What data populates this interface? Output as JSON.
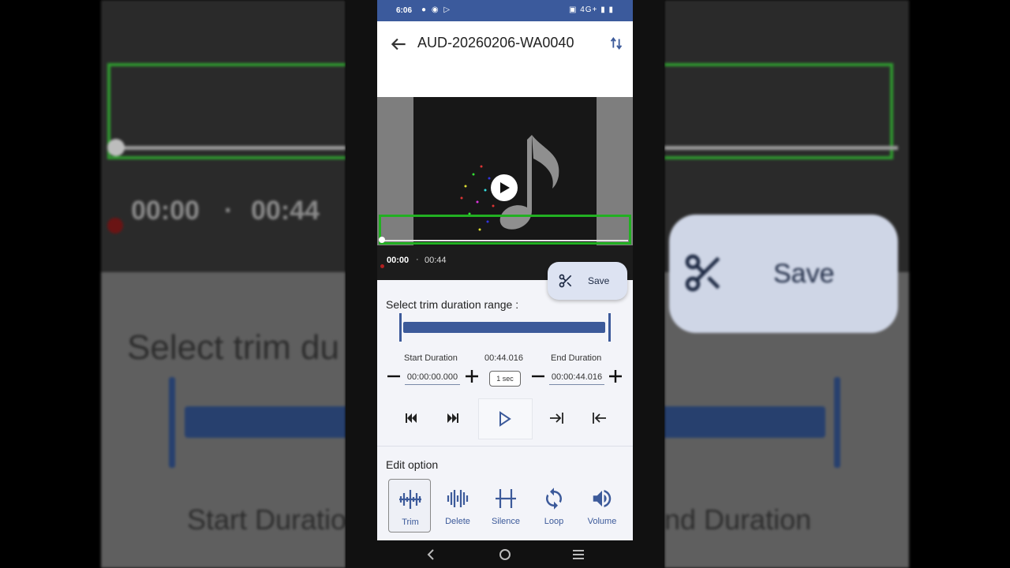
{
  "status_bar": {
    "time": "6:06",
    "network": "4G+"
  },
  "header": {
    "title": "AUD-20260206-WA0040"
  },
  "player": {
    "current_time": "00:00",
    "separator": "·",
    "total_time": "00:44"
  },
  "save_button": {
    "label": "Save"
  },
  "trim": {
    "section_label": "Select trim duration range :",
    "start_label": "Start Duration",
    "duration_value": "00:44.016",
    "end_label": "End Duration",
    "start_value": "00:00:00.000",
    "end_value": "00:00:44.016",
    "step_label": "1 sec"
  },
  "edit": {
    "section_label": "Edit option",
    "options": [
      {
        "label": "Trim",
        "selected": true
      },
      {
        "label": "Delete",
        "selected": false
      },
      {
        "label": "Silence",
        "selected": false
      },
      {
        "label": "Loop",
        "selected": false
      },
      {
        "label": "Volume",
        "selected": false
      }
    ]
  },
  "colors": {
    "accent": "#3c5a9a",
    "status_bar": "#3b5a9c",
    "selection": "#22b022"
  },
  "background": {
    "time_current": "00:00",
    "time_dot": "·",
    "time_total": "00:44",
    "trim_text": "Select trim du",
    "start_text": "Start Duratio",
    "end_text": "nd Duration",
    "save_text": "Save"
  }
}
